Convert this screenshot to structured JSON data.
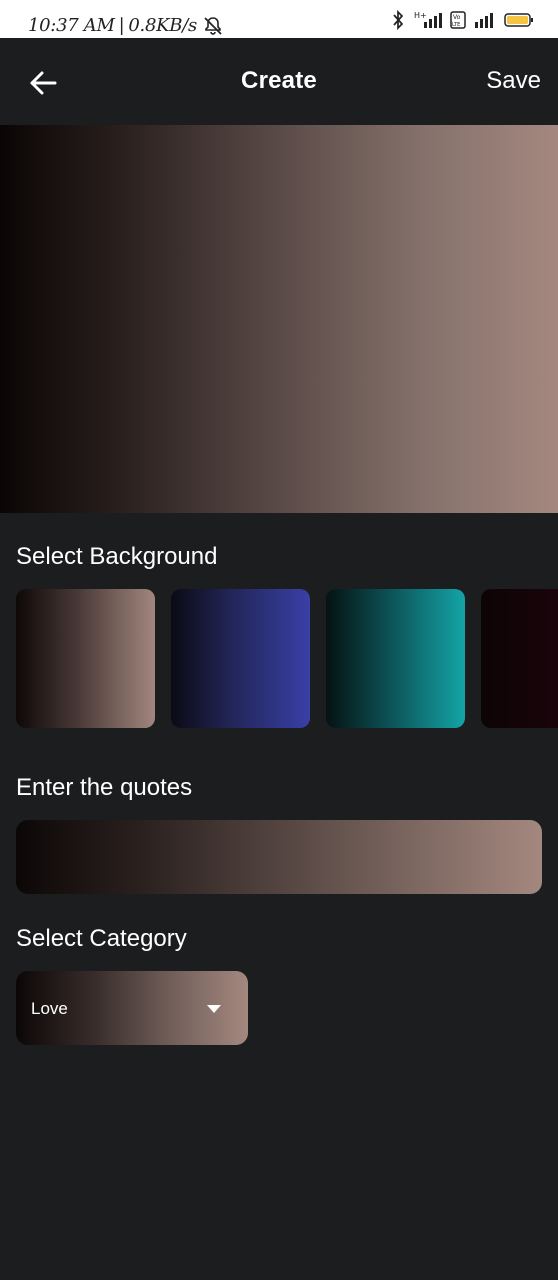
{
  "status_bar": {
    "time": "10:37 AM",
    "separator": "|",
    "speed": "0.8KB/s",
    "icons": [
      "bell-off-icon",
      "bluetooth-icon",
      "signal-hplus-icon",
      "volte-icon",
      "signal-icon",
      "battery-icon"
    ],
    "battery_color": "#f5c542"
  },
  "app_bar": {
    "back_icon": "arrow-left-icon",
    "title": "Create",
    "save_label": "Save"
  },
  "preview": {
    "gradient": [
      "#0a0505",
      "#a4887f"
    ]
  },
  "background_section": {
    "label": "Select Background",
    "swatches": [
      {
        "name": "brown-rose",
        "colors": [
          "#0e0808",
          "#a2867e"
        ]
      },
      {
        "name": "indigo",
        "colors": [
          "#0b0a14",
          "#3940a6"
        ]
      },
      {
        "name": "teal",
        "colors": [
          "#051212",
          "#14a4a6"
        ]
      },
      {
        "name": "wine",
        "colors": [
          "#0d0405",
          "#23040f"
        ]
      }
    ]
  },
  "quote_section": {
    "label": "Enter the quotes",
    "value": "",
    "placeholder": ""
  },
  "category_section": {
    "label": "Select Category",
    "selected": "Love"
  },
  "colors": {
    "background": "#1c1d1f",
    "text": "#ffffff"
  }
}
